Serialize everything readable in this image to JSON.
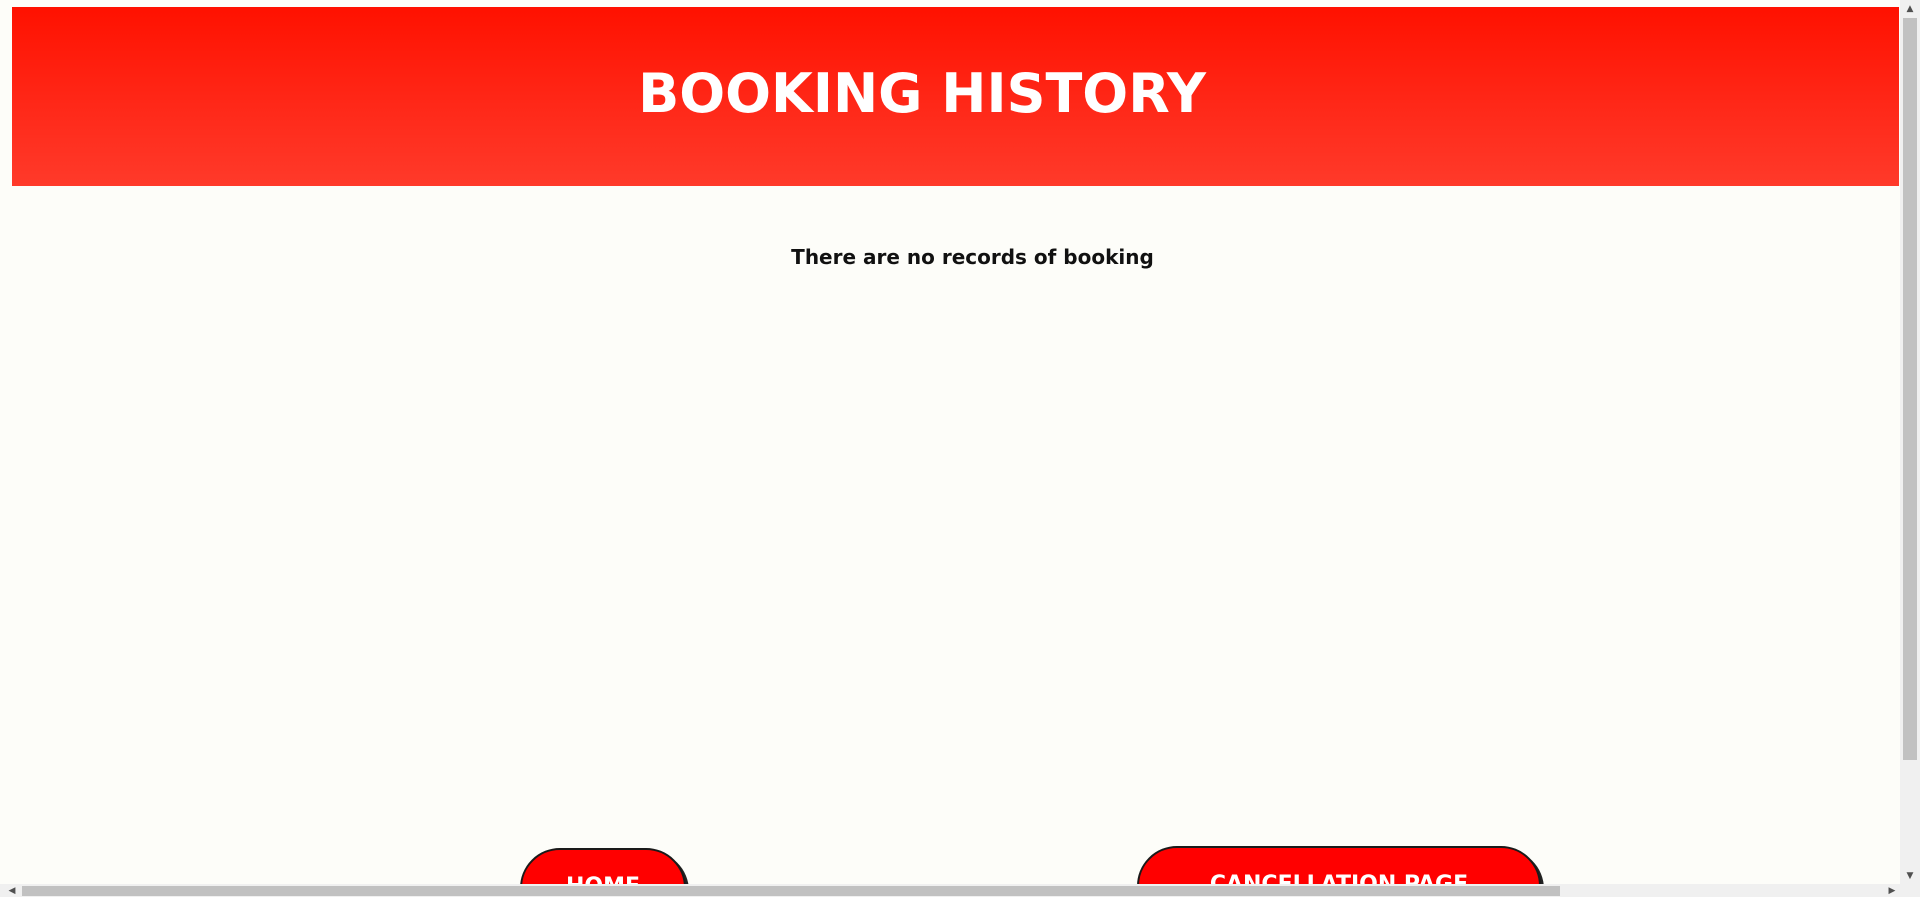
{
  "header": {
    "title": "BOOKING HISTORY",
    "background_color": "#ff1100"
  },
  "main": {
    "empty_message": "There are no records of booking"
  },
  "nav": {
    "home_label": "HOME",
    "cancellation_label": "CANCELLATION PAGE",
    "button_color": "#ff0000"
  },
  "icons": {
    "scroll_up": "▲",
    "scroll_down": "▼",
    "scroll_left": "◀",
    "scroll_right": "▶"
  }
}
